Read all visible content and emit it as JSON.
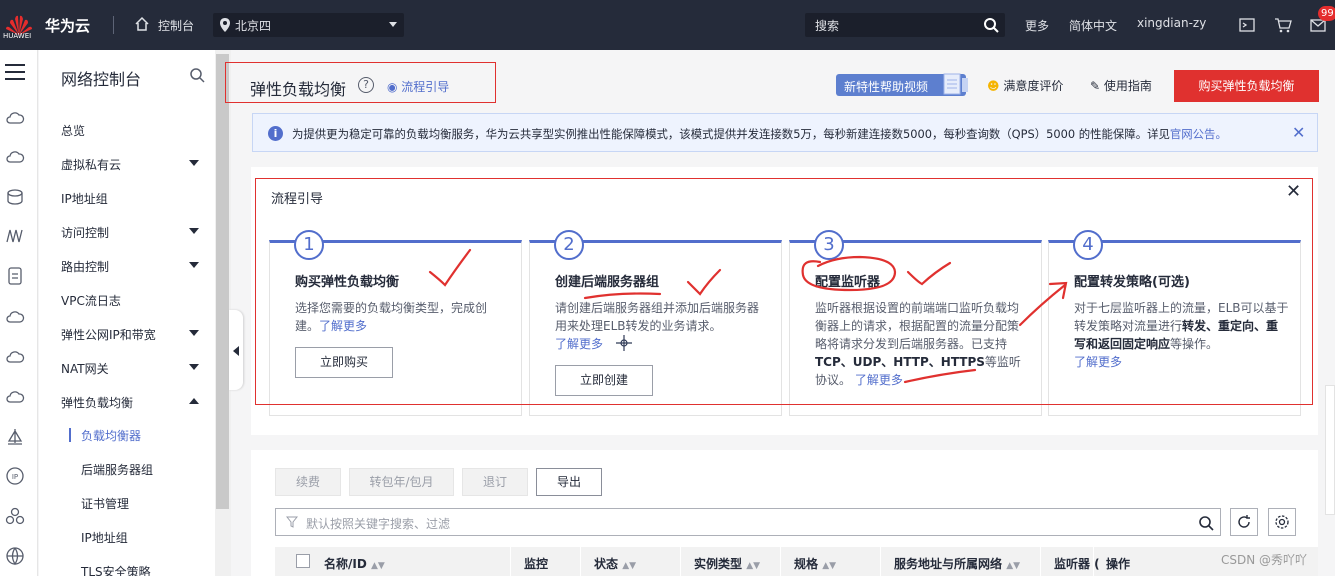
{
  "topbar": {
    "logo_text": "HUAWEI",
    "brand": "华为云",
    "console": "控制台",
    "region": "北京四",
    "search_placeholder": "搜索",
    "more": "更多",
    "language": "简体中文",
    "user": "xingdian-zy",
    "mail_badge": "99",
    "icons": [
      "terminal-icon",
      "cart-icon",
      "mail-icon"
    ]
  },
  "rail_icons": [
    "menu-icon",
    "cloud-icon",
    "cloud-icon",
    "database-icon",
    "network-icon",
    "document-icon",
    "cloud-icon",
    "cloud-icon",
    "cloud-icon",
    "sail-icon",
    "ip-icon",
    "cluster-icon",
    "globe-icon"
  ],
  "sidenav": {
    "title": "网络控制台",
    "items": [
      {
        "label": "总览"
      },
      {
        "label": "虚拟私有云"
      },
      {
        "label": "IP地址组"
      },
      {
        "label": "访问控制"
      },
      {
        "label": "路由控制"
      },
      {
        "label": "VPC流日志"
      },
      {
        "label": "弹性公网IP和带宽"
      },
      {
        "label": "NAT网关"
      },
      {
        "label": "弹性负载均衡"
      },
      {
        "label": "负载均衡器"
      },
      {
        "label": "后端服务器组"
      },
      {
        "label": "证书管理"
      },
      {
        "label": "IP地址组"
      },
      {
        "label": "TLS安全策略"
      }
    ]
  },
  "header": {
    "title": "弹性负载均衡",
    "help": "?",
    "flow_link": "流程引导",
    "new_video": "新特性帮助视频",
    "satisfaction": "满意度评价",
    "guide": "使用指南",
    "buy_button": "购买弹性负载均衡"
  },
  "notice": {
    "text": "为提供更为稳定可靠的负载均衡服务，华为云共享型实例推出性能保障模式，该模式提供并发连接数5万，每秒新建连接数5000，每秒查询数（QPS）5000 的性能保障。详见",
    "link": "官网公告。"
  },
  "flow": {
    "title": "流程引导",
    "steps": [
      {
        "num": "1",
        "title": "购买弹性负载均衡",
        "desc": "选择您需要的负载均衡类型，完成创建。",
        "link": "了解更多",
        "button": "立即购买"
      },
      {
        "num": "2",
        "title": "创建后端服务器组",
        "desc": "请创建后端服务器组并添加后端服务器用来处理ELB转发的业务请求。",
        "link": "了解更多",
        "button": "立即创建"
      },
      {
        "num": "3",
        "title": "配置监听器",
        "desc_a": "监听器根据设置的前端端口监听负载均衡器上的请求，根据配置的流量分配策略将请求分发到后端服务器。已支持",
        "desc_b": "TCP、UDP、HTTP、HTTPS",
        "desc_c": "等监听协议。",
        "link": "了解更多"
      },
      {
        "num": "4",
        "title": "配置转发策略(可选)",
        "desc_a": "对于七层监听器上的流量，ELB可以基于转发策略对流量进行",
        "desc_b": "转发、重定向、重写和返回固定响应",
        "desc_c": "等操作。",
        "link": "了解更多"
      }
    ]
  },
  "toolbar": {
    "renew": "续费",
    "to_yearly": "转包年/包月",
    "unsubscribe": "退订",
    "export": "导出"
  },
  "filter": {
    "placeholder": "默认按照关键字搜索、过滤"
  },
  "table": {
    "columns": [
      "名称/ID",
      "监控",
      "状态",
      "实例类型",
      "规格",
      "服务地址与所属网络",
      "监听器 (",
      "操作"
    ]
  },
  "watermark": "CSDN @秀吖吖",
  "colors": {
    "accent": "#526ecc",
    "topbar": "#252b3a",
    "buy": "#e0312f",
    "annotation": "#e0312f"
  }
}
